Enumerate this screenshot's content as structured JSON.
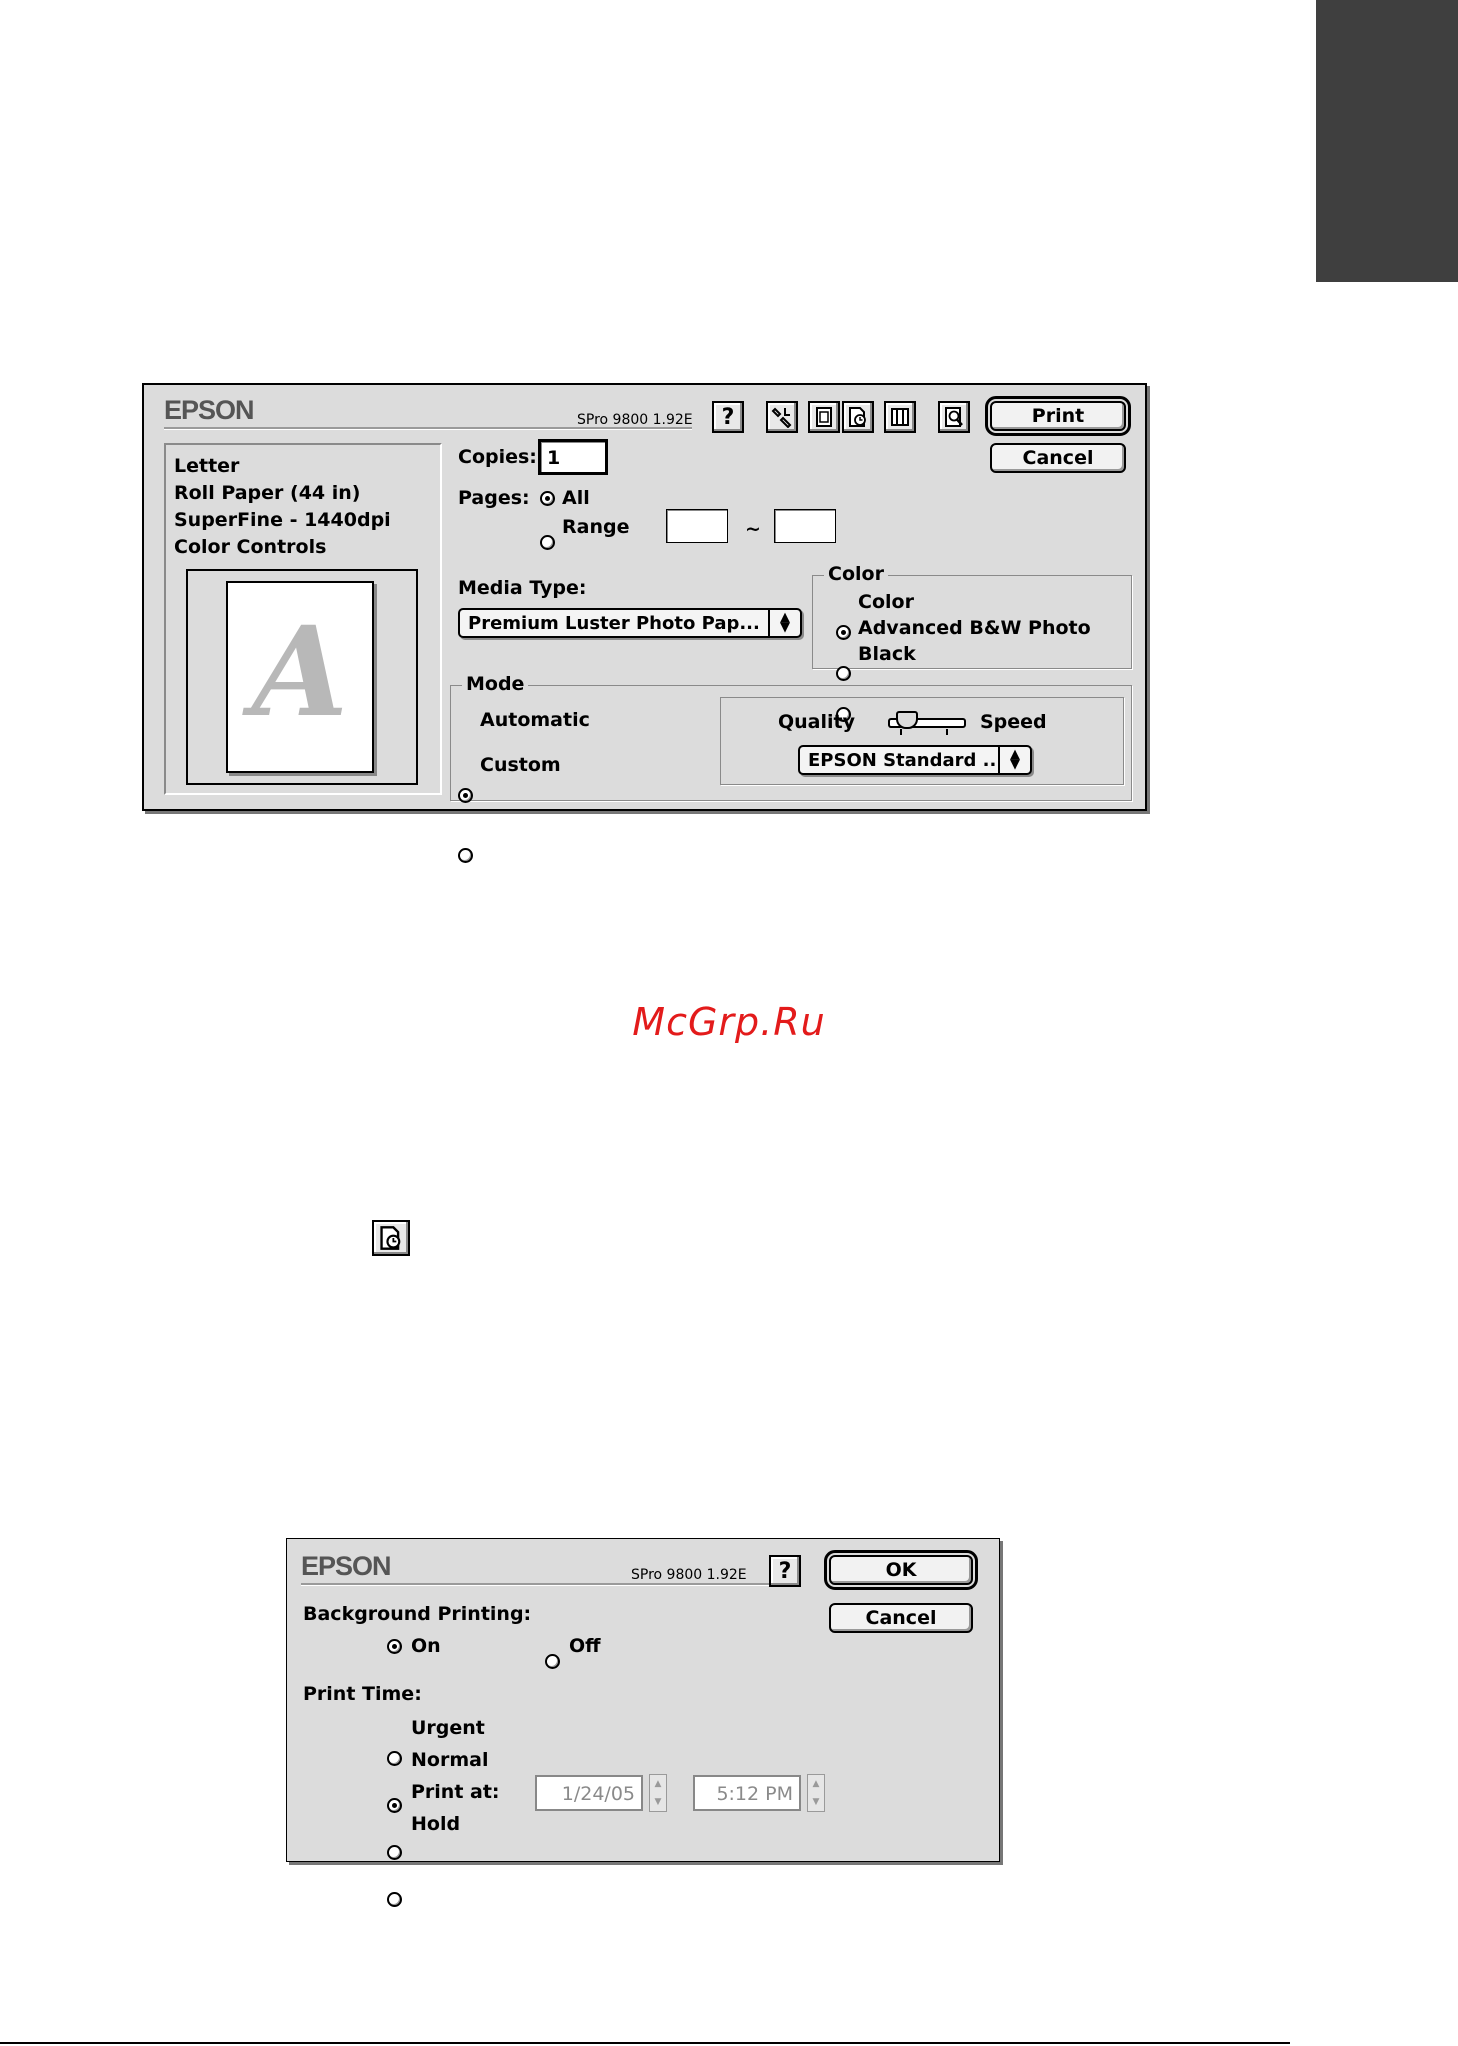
{
  "watermark": "McGrp.Ru",
  "print_dialog": {
    "brand": "EPSON",
    "version": "SPro 9800 1.92E",
    "help_label": "?",
    "print_label": "Print",
    "cancel_label": "Cancel",
    "summary": [
      "Letter",
      "Roll Paper (44 in)",
      "SuperFine - 1440dpi",
      "Color Controls"
    ],
    "preview_glyph": "A",
    "copies_label": "Copies:",
    "copies_value": "1",
    "pages_label": "Pages:",
    "pages_all_label": "All",
    "pages_range_label": "Range",
    "pages_selected": "All",
    "range_separator": "~",
    "range_from": "",
    "range_to": "",
    "media_type_label": "Media Type:",
    "media_type_value": "Premium Luster Photo Pap...",
    "color_group_title": "Color",
    "color_options": [
      "Color",
      "Advanced B&W Photo",
      "Black"
    ],
    "color_selected": "Color",
    "mode_group_title": "Mode",
    "mode_options": [
      "Automatic",
      "Custom"
    ],
    "mode_selected": "Automatic",
    "quality_label": "Quality",
    "speed_label": "Speed",
    "quality_speed_level": 0.15,
    "mode_setting_value": "EPSON Standard ...",
    "toolbar_icons": [
      "utility-icon",
      "layout-icon",
      "background-printing-icon",
      "roll-paper-icon",
      "preview-icon"
    ]
  },
  "standalone_icon": "background-printing-icon",
  "bg_dialog": {
    "brand": "EPSON",
    "version": "SPro 9800 1.92E",
    "help_label": "?",
    "ok_label": "OK",
    "cancel_label": "Cancel",
    "background_printing_label": "Background Printing:",
    "bg_on_label": "On",
    "bg_off_label": "Off",
    "bg_selected": "On",
    "print_time_label": "Print Time:",
    "print_time_options": [
      "Urgent",
      "Normal",
      "Print at:",
      "Hold"
    ],
    "print_time_selected": "Normal",
    "print_at_date": "1/24/05",
    "print_at_time": "5:12 PM"
  }
}
